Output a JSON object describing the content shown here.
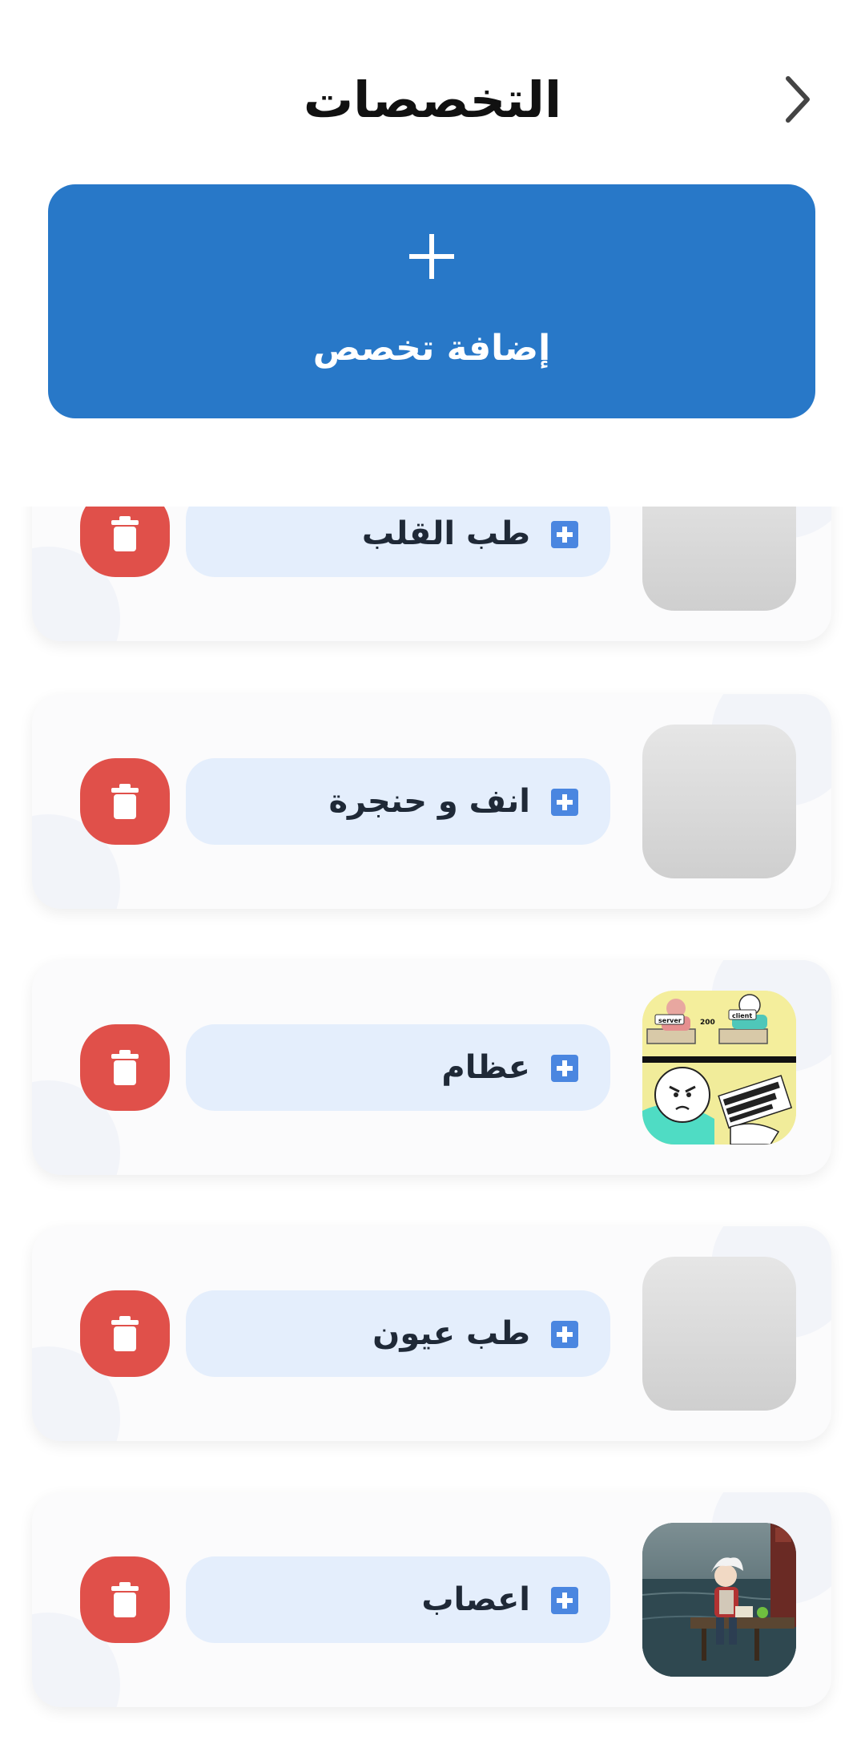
{
  "header": {
    "title": "التخصصات",
    "back_icon": "chevron-right-icon"
  },
  "add_button": {
    "label": "إضافة تخصص",
    "icon": "plus-icon"
  },
  "specialties": [
    {
      "name": "طب القلب",
      "image": "placeholder"
    },
    {
      "name": "انف و حنجرة",
      "image": "placeholder"
    },
    {
      "name": "عظام",
      "image": "meme-comic"
    },
    {
      "name": "طب عيون",
      "image": "placeholder"
    },
    {
      "name": "اعصاب",
      "image": "anime-character-pier"
    }
  ],
  "colors": {
    "primary": "#2878c8",
    "delete": "#e0504a",
    "pill": "#e4eefc",
    "pill_icon": "#4a86e0",
    "text": "#1f2937"
  }
}
